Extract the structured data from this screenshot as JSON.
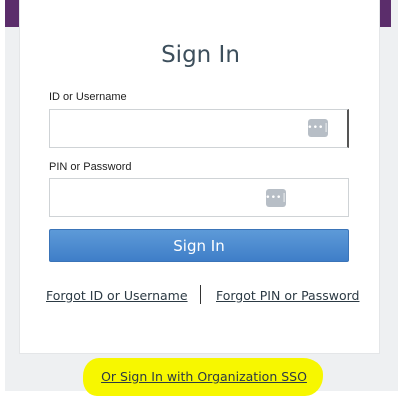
{
  "card": {
    "title": "Sign In",
    "id_label": "ID or Username",
    "id_value": "",
    "pin_label": "PIN or Password",
    "pin_value": "",
    "password_manager_icon": "password-dots-icon",
    "password_manager_icon_text": "•••|",
    "signin_button": "Sign In",
    "forgot_id_link": "Forgot ID or Username",
    "forgot_pin_link": "Forgot PIN or Password"
  },
  "sso_link": "Or Sign In with Organization SSO",
  "colors": {
    "accent": "#5b2d6b",
    "button": "#4a8ad0",
    "highlight": "#f7f700"
  }
}
